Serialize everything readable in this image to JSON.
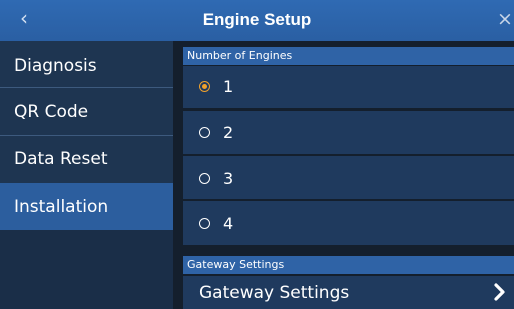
{
  "header": {
    "title": "Engine Setup",
    "back_glyph": "‹",
    "close_glyph": "×"
  },
  "sidebar": {
    "items": [
      {
        "label": "Diagnosis",
        "active": false
      },
      {
        "label": "QR Code",
        "active": false
      },
      {
        "label": "Data Reset",
        "active": false
      },
      {
        "label": "Installation",
        "active": true
      }
    ]
  },
  "engines": {
    "header": "Number of Engines",
    "options": [
      {
        "label": "1",
        "selected": true
      },
      {
        "label": "2",
        "selected": false
      },
      {
        "label": "3",
        "selected": false
      },
      {
        "label": "4",
        "selected": false
      }
    ]
  },
  "gateway": {
    "header": "Gateway Settings",
    "row_label": "Gateway Settings",
    "row_icon": "chevron-right-icon"
  },
  "colors": {
    "titlebar": "#2f6ab3",
    "accent": "#f0a12c",
    "row_bg": "#1f3a5e",
    "sidebar_active": "#2c5e9e"
  }
}
